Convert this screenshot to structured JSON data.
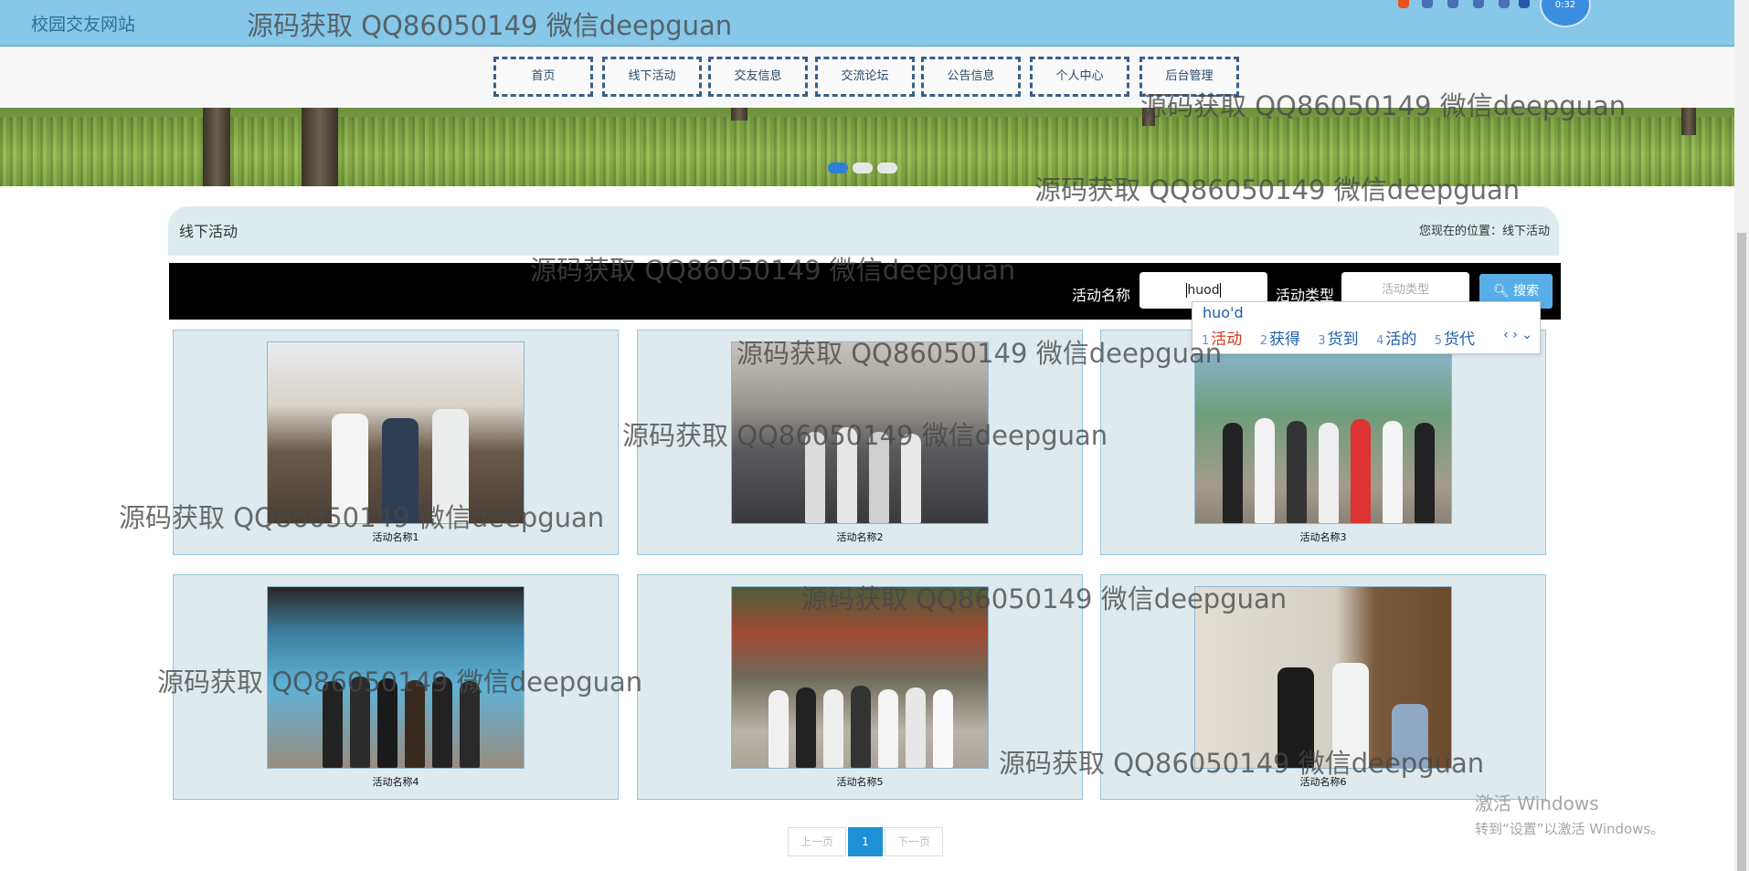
{
  "header": {
    "site_title": "校园交友网站",
    "watermark_text": "源码获取 QQ86050149 微信deepguan"
  },
  "nav": {
    "items": [
      "首页",
      "线下活动",
      "交友信息",
      "交流论坛",
      "公告信息",
      "个人中心",
      "后台管理"
    ]
  },
  "banner": {
    "slides": 3,
    "active_slide": 1
  },
  "content": {
    "section_title": "线下活动",
    "breadcrumb": "您现在的位置：线下活动"
  },
  "search": {
    "name_label": "活动名称",
    "name_value": "huod",
    "type_label": "活动类型",
    "type_placeholder": "活动类型",
    "button_label": "搜索"
  },
  "ime": {
    "composition": "huo'd",
    "candidates": [
      {
        "num": "1",
        "text": "活动"
      },
      {
        "num": "2",
        "text": "获得"
      },
      {
        "num": "3",
        "text": "货到"
      },
      {
        "num": "4",
        "text": "活的"
      },
      {
        "num": "5",
        "text": "货代"
      }
    ],
    "nav_arrows": "‹ › ⌄"
  },
  "activities": [
    {
      "name": "活动名称1"
    },
    {
      "name": "活动名称2"
    },
    {
      "name": "活动名称3"
    },
    {
      "name": "活动名称4"
    },
    {
      "name": "活动名称5"
    },
    {
      "name": "活动名称6"
    }
  ],
  "pager": {
    "prev": "上一页",
    "current": "1",
    "next": "下一页"
  },
  "windows": {
    "activate_title": "激活 Windows",
    "activate_sub": "转到“设置”以激活 Windows。"
  },
  "tray": {
    "avatar_text": "0:32"
  },
  "colors": {
    "header_bg": "#87c7e7",
    "card_bg": "#deeaee",
    "accent": "#1e90d6"
  }
}
